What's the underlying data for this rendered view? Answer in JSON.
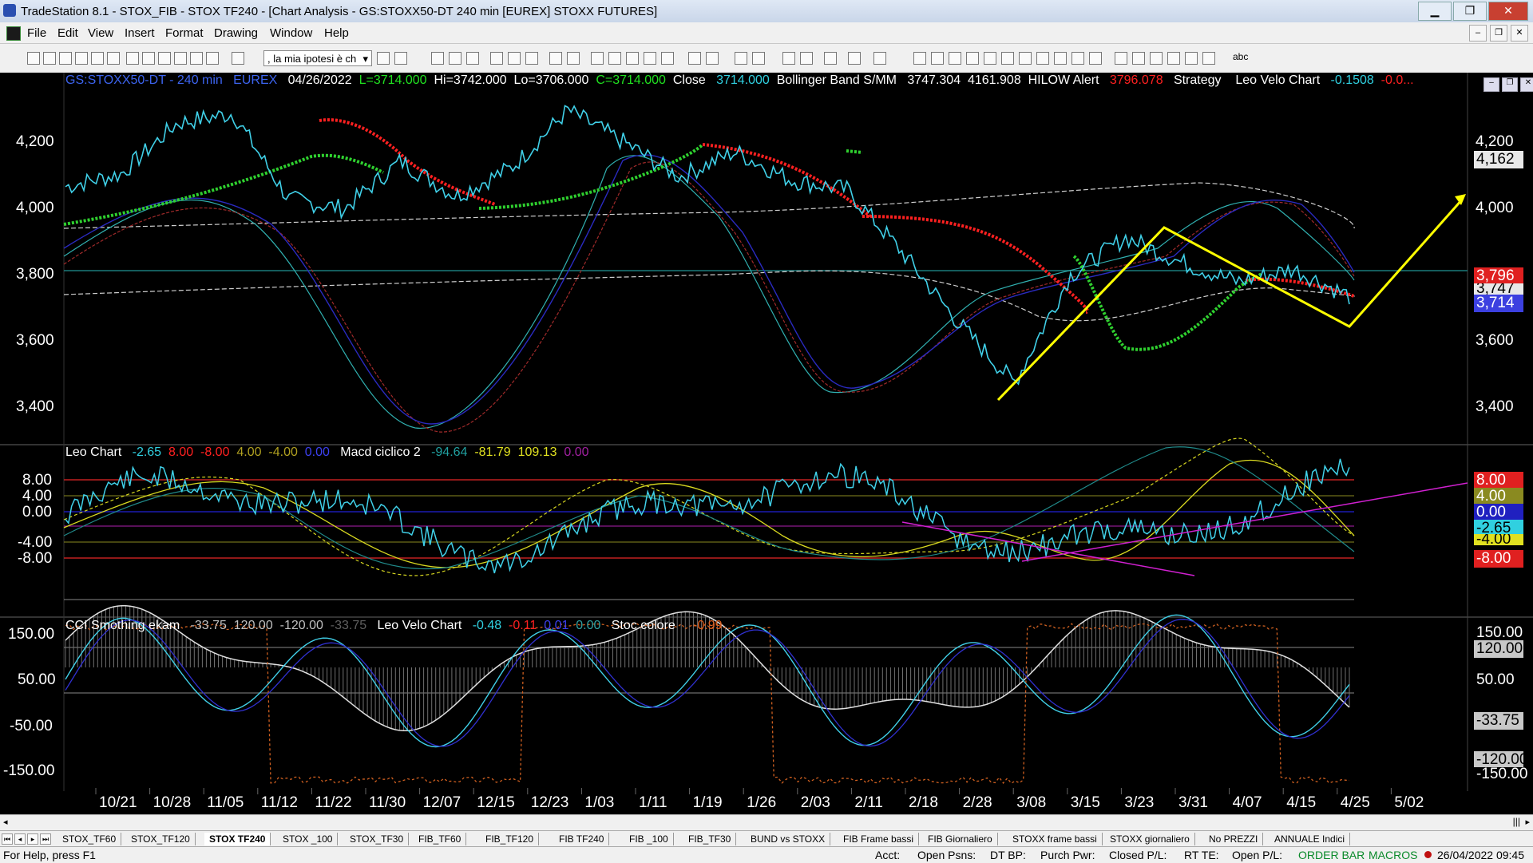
{
  "window": {
    "title": "TradeStation 8.1 - STOX_FIB - STOX TF240 - [Chart Analysis - GS:STOXX50-DT  240 min  [EUREX] STOXX FUTURES]"
  },
  "menu": [
    "File",
    "Edit",
    "View",
    "Insert",
    "Format",
    "Drawing",
    "Window",
    "Help"
  ],
  "toolbar": {
    "combo_value": ", la mia ipotesi è ch",
    "abc": "abc"
  },
  "price_pane": {
    "symbol": "GS:STOXX50-DT - 240 min",
    "exchange": "EUREX",
    "date": "04/26/2022",
    "last": "L=3714.000",
    "hi": "Hi=3742.000",
    "lo": "Lo=3706.000",
    "close_c": "C=3714.000",
    "close_word": "Close",
    "close_val": "3714.000",
    "bb_name": "Bollinger Band S/MM",
    "bb_v1": "3747.304",
    "bb_v2": "4161.908",
    "hilow_name": "HILOW Alert",
    "hilow_val": "3796.078",
    "strategy": "Strategy",
    "leo_name": "Leo Velo Chart",
    "leo_v1": "-0.1508",
    "leo_v2": "-0.0...",
    "y_ticks": [
      "4,200",
      "4,000",
      "3,800",
      "3,600",
      "3,400"
    ],
    "tags": {
      "t1": "4,162",
      "t2": "3,796",
      "t3": "3,747",
      "t4": "3,714"
    }
  },
  "leo_pane": {
    "name": "Leo Chart",
    "v1": "-2.65",
    "v2": "8.00",
    "v3": "-8.00",
    "v4": "4.00",
    "v5": "-4.00",
    "v6": "0.00",
    "macd_name": "Macd ciclico 2",
    "m1": "-94.64",
    "m2": "-81.79",
    "m3": "109.13",
    "m4": "0.00",
    "y_ticks": [
      "8.00",
      "4.00",
      "0.00",
      "-4.00",
      "-8.00"
    ],
    "tags": {
      "a": "8.00",
      "b": "4.00",
      "c": "0.00",
      "d": "-2.65",
      "e": "-4.00",
      "f": "-8.00"
    }
  },
  "cci_pane": {
    "name": "CCI Smothing ekam",
    "c1": "-33.75",
    "c2": "120.00",
    "c3": "-120.00",
    "c4": "-33.75",
    "leo_name": "Leo Velo Chart",
    "l1": "-0.48",
    "l2": "-0.11",
    "l3": "0.01",
    "l4": "0.00",
    "stoc_name": "Stoc colore",
    "s1": "-0.99",
    "y_ticks": [
      "150.00",
      "50.00",
      "-50.00",
      "-150.00"
    ],
    "tags": {
      "a": "150.00",
      "b": "120.00",
      "c": "50.00",
      "d": "-33.75",
      "e": "-120.00",
      "f": "-150.00"
    }
  },
  "x_axis": [
    "10/21",
    "10/28",
    "11/05",
    "11/12",
    "11/22",
    "11/30",
    "12/07",
    "12/15",
    "12/23",
    "1/03",
    "1/11",
    "1/19",
    "1/26",
    "2/03",
    "2/11",
    "2/18",
    "2/28",
    "3/08",
    "3/15",
    "3/23",
    "3/31",
    "4/07",
    "4/15",
    "4/25",
    "5/02"
  ],
  "tabs": [
    "STOX_TF60",
    "STOX_TF120",
    "STOX TF240",
    "STOX _100",
    "STOX_TF30",
    "FIB_TF60",
    "FIB_TF120",
    "FIB TF240",
    "FIB _100",
    "FIB_TF30",
    "BUND vs STOXX",
    "FIB Frame bassi",
    "FIB Giornaliero",
    "STOXX frame bassi",
    "STOXX giornaliero",
    "No PREZZI",
    "ANNUALE Indici"
  ],
  "status": {
    "help": "For Help, press F1",
    "acct": "Acct:",
    "open_psns": "Open Psns:",
    "dt_bp": "DT BP:",
    "purch_pwr": "Purch Pwr:",
    "closed_pl": "Closed P/L:",
    "rt_te": "RT TE:",
    "open_pl": "Open P/L:",
    "order_bar": "ORDER BAR",
    "macros": "MACROS",
    "datetime": "26/04/2022 09:45"
  },
  "chart_data": {
    "type": "line",
    "x": [
      "10/21",
      "10/28",
      "11/05",
      "11/12",
      "11/22",
      "11/30",
      "12/07",
      "12/15",
      "12/23",
      "1/03",
      "1/11",
      "1/19",
      "1/26",
      "2/03",
      "2/11",
      "2/18",
      "2/28",
      "3/08",
      "3/15",
      "3/23",
      "3/31",
      "4/07",
      "4/15",
      "4/25"
    ],
    "series": [
      {
        "values": [
          4060,
          4100,
          4260,
          4290,
          4020,
          3990,
          4140,
          4030,
          4120,
          4300,
          4200,
          4090,
          4170,
          4080,
          4050,
          3850,
          3630,
          3440,
          3780,
          3900,
          3820,
          3760,
          3800,
          3714
        ]
      }
    ],
    "ylim": [
      3300,
      4350
    ]
  }
}
